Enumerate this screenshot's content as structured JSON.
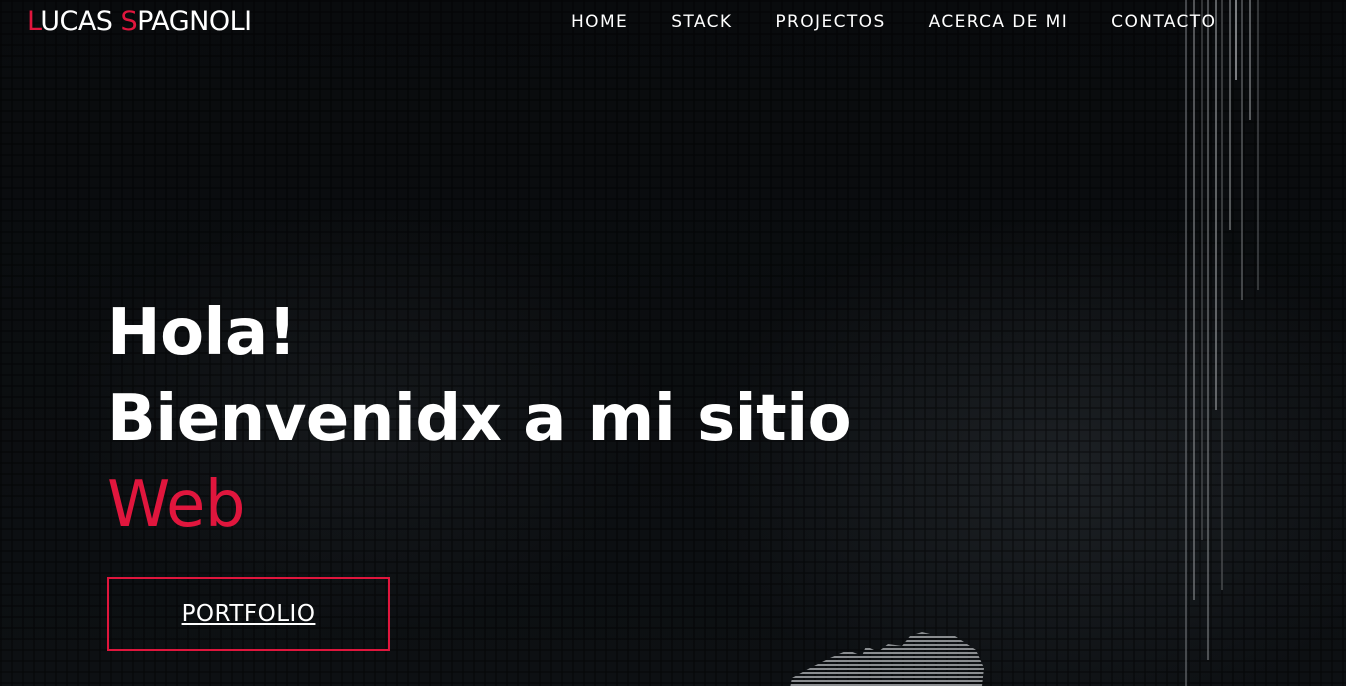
{
  "brand": {
    "initial_1": "L",
    "rest_1": "UCAS ",
    "initial_2": "S",
    "rest_2": "PAGNOLI"
  },
  "nav": {
    "items": [
      {
        "label": "HOME"
      },
      {
        "label": "STACK"
      },
      {
        "label": "PROJECTOS"
      },
      {
        "label": "ACERCA DE MI"
      },
      {
        "label": "CONTACTO"
      }
    ]
  },
  "hero": {
    "line_1": "Hola!",
    "line_2": "Bienvenidx a mi sitio",
    "line_3": "Web",
    "cta_label": "PORTFOLIO"
  },
  "colors": {
    "accent": "#e0163d",
    "background": "#0b0d10",
    "text": "#ffffff"
  }
}
